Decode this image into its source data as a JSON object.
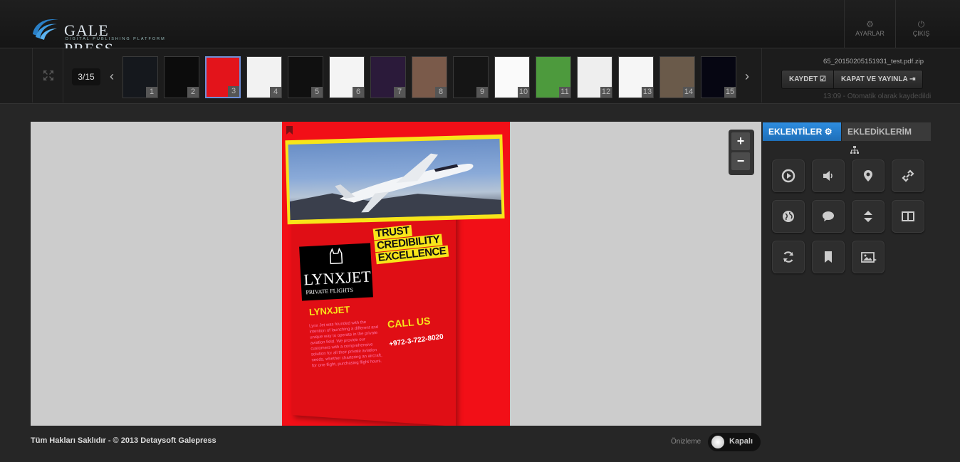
{
  "header": {
    "brand": "GALE PRESS",
    "brand_sub": "DIGITAL PUBLISHING PLATFORM",
    "settings_label": "AYARLAR",
    "logout_label": "ÇIKIŞ"
  },
  "toolbar": {
    "page_counter": "3/15",
    "current_page": 3,
    "total_pages": 15,
    "thumbnails": [
      {
        "num": "1",
        "color": "#15181d"
      },
      {
        "num": "2",
        "color": "#0c0c0c"
      },
      {
        "num": "3",
        "color": "#e3141b"
      },
      {
        "num": "4",
        "color": "#f2f2f2"
      },
      {
        "num": "5",
        "color": "#101010"
      },
      {
        "num": "6",
        "color": "#f4f4f4"
      },
      {
        "num": "7",
        "color": "#2b1a3a"
      },
      {
        "num": "8",
        "color": "#7a5a4a"
      },
      {
        "num": "9",
        "color": "#151515"
      },
      {
        "num": "10",
        "color": "#fafafa"
      },
      {
        "num": "11",
        "color": "#4d9a3d"
      },
      {
        "num": "12",
        "color": "#eeeeee"
      },
      {
        "num": "13",
        "color": "#f6f6f6"
      },
      {
        "num": "14",
        "color": "#6a5a4a"
      },
      {
        "num": "15",
        "color": "#060612"
      }
    ],
    "filename": "65_20150205151931_test.pdf.zip",
    "save_label": "KAYDET",
    "close_publish_label": "KAPAT VE YAYINLA",
    "autosave_text": "13:09 - Otomatik olarak kaydedildi"
  },
  "page_content": {
    "tagline": [
      "TRUST",
      "CREDIBILITY",
      "EXCELLENCE"
    ],
    "logo_name": "LYNXJET",
    "logo_sub": "PRIVATE FLIGHTS",
    "heading": "LYNXJET",
    "body": "Lynx Jet was founded with the intention of launching a different and unique way to operate in the private aviation field. We provide our customers with a comprehensive solution for all their private aviation needs, whether chartering an aircraft, for one flight, purchasing flight hours.",
    "call_us": "CALL US",
    "phone": "+972-3-722-8020"
  },
  "zoom": {
    "in": "+",
    "out": "−"
  },
  "sidebar": {
    "tab_plugins": "EKLENTİLER",
    "tab_added": "EKLEDİKLERİM",
    "tools": [
      "video-icon",
      "audio-icon",
      "map-pin-icon",
      "link-icon",
      "web-icon",
      "tooltip-icon",
      "scroller-icon",
      "slideshow-icon",
      "animation-icon",
      "bookmark-icon",
      "gallery-icon"
    ]
  },
  "footer": {
    "copyright": "Tüm Hakları Saklıdır - © 2013 Detaysoft Galepress",
    "preview_label": "Önizleme",
    "preview_state": "Kapalı"
  }
}
